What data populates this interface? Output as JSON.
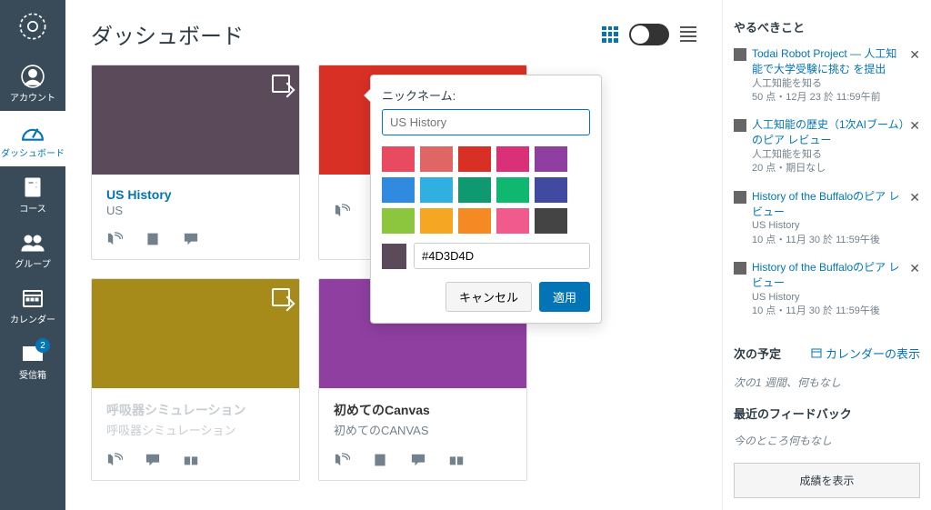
{
  "nav": {
    "items": [
      {
        "label": "アカウント"
      },
      {
        "label": "ダッシュボード"
      },
      {
        "label": "コース"
      },
      {
        "label": "グループ"
      },
      {
        "label": "カレンダー"
      },
      {
        "label": "受信箱",
        "badge": "2"
      }
    ]
  },
  "header": {
    "title": "ダッシュボード"
  },
  "cards": [
    {
      "title": "US History",
      "sub": "US",
      "color": "#5b4a5a",
      "title_color": "#0374b5"
    },
    {
      "title": "",
      "sub": "",
      "color": "#d93025"
    },
    {
      "title": "呼吸器シミュレーション",
      "sub": "呼吸器シミュレーション",
      "color": "#a68a1a",
      "disabled": true,
      "title_color": "#c7cdd1"
    },
    {
      "title": "初めてのCanvas",
      "sub": "初めてのCANVAS",
      "color": "#8f3fa0",
      "title_color": "#333"
    }
  ],
  "popover": {
    "label": "ニックネーム:",
    "placeholder": "US History",
    "hex": "#4D3D4D",
    "sel_color": "#5b4a5a",
    "swatches": [
      "#e84a5f",
      "#e06666",
      "#d93025",
      "#d93078",
      "#8f3fa0",
      "#2f8ae0",
      "#2fb0e0",
      "#0f9970",
      "#0fb770",
      "#3f4aa0",
      "#8cc63f",
      "#f5a623",
      "#f58a23",
      "#f05a8c",
      "#444444"
    ],
    "cancel": "キャンセル",
    "apply": "適用"
  },
  "side": {
    "todo_heading": "やるべきこと",
    "todos": [
      {
        "link": "Todai Robot Project — 人工知能で大学受験に挑む を提出",
        "meta": "人工知能を知る",
        "meta2": "50 点・12月 23 於 11:59午前"
      },
      {
        "link": "人工知能の歴史（1次AIブーム）のピア レビュー",
        "meta": "人工知能を知る",
        "meta2": "20 点・期日なし"
      },
      {
        "link": "History of the Buffaloのピア レビュー",
        "meta": "US History",
        "meta2": "10 点・11月 30 於 11:59午後"
      },
      {
        "link": "History of the Buffaloのピア レビュー",
        "meta": "US History",
        "meta2": "10 点・11月 30 於 11:59午後"
      }
    ],
    "upcoming_heading": "次の予定",
    "calendar_link": "カレンダーの表示",
    "upcoming_empty": "次の1 週間、何もなし",
    "feedback_heading": "最近のフィードバック",
    "feedback_empty": "今のところ何もなし",
    "grades_btn": "成績を表示"
  }
}
